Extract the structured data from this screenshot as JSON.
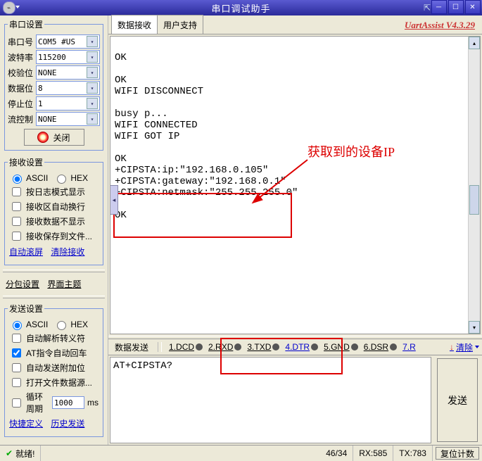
{
  "titlebar": {
    "title": "串口调试助手"
  },
  "brand": "UartAssist V4.3.29",
  "sidebar": {
    "port_group": {
      "legend": "串口设置",
      "port_label": "串口号",
      "port_value": "COM5 #US",
      "baud_label": "波特率",
      "baud_value": "115200",
      "parity_label": "校验位",
      "parity_value": "NONE",
      "data_label": "数据位",
      "data_value": "8",
      "stop_label": "停止位",
      "stop_value": "1",
      "flow_label": "流控制",
      "flow_value": "NONE",
      "open_btn": "关闭"
    },
    "recv_group": {
      "legend": "接收设置",
      "ascii": "ASCII",
      "hex": "HEX",
      "log_mode": "按日志模式显示",
      "auto_wrap": "接收区自动换行",
      "hide_recv": "接收数据不显示",
      "save_file": "接收保存到文件...",
      "auto_scroll": "自动滚屏",
      "clear_recv": "清除接收"
    },
    "mid": {
      "pkg": "分包设置",
      "theme": "界面主题"
    },
    "send_group": {
      "legend": "发送设置",
      "ascii": "ASCII",
      "hex": "HEX",
      "auto_escape": "自动解析转义符",
      "at_cr": "AT指令自动回车",
      "auto_append": "自动发送附加位",
      "open_file": "打开文件数据源...",
      "cycle": "循环周期",
      "cycle_val": "1000",
      "ms": "ms",
      "shortcut": "快捷定义",
      "history": "历史发送"
    }
  },
  "main": {
    "tabs": {
      "recv": "数据接收",
      "support": "用户支持"
    },
    "rx_text": "\nOK\n\nOK\nWIFI DISCONNECT\n\nbusy p...\nWIFI CONNECTED\nWIFI GOT IP\n\nOK\n+CIPSTA:ip:\"192.168.0.105\"\n+CIPSTA:gateway:\"192.168.0.1\"\n+CIPSTA:netmask:\"255.255.255.0\"\n\nOK\n",
    "tx_header": {
      "label": "数据发送",
      "sig1": "1.DCD",
      "sig2": "2.RXD",
      "sig3": "3.TXD",
      "sig4": "4.DTR",
      "sig5": "5.GND",
      "sig6": "6.DSR",
      "sig7": "7.R",
      "clear": "清除"
    },
    "tx_value": "AT+CIPSTA?",
    "send_btn": "发送"
  },
  "annotation": {
    "label": "获取到的设备IP"
  },
  "status": {
    "ready": "就绪!",
    "counts": "46/34",
    "rx": "RX:585",
    "tx": "TX:783",
    "reset": "复位计数"
  }
}
